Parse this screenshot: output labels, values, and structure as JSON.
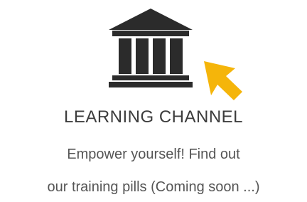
{
  "card": {
    "icon": "institution-building-icon",
    "pointer_icon": "cursor-arrow-icon",
    "title": "LEARNING CHANNEL",
    "description_line1": "Empower yourself! Find out",
    "description_line2": "our training pills (Coming soon ...)"
  },
  "colors": {
    "icon": "#2b2b2b",
    "pointer": "#f5b50a",
    "title": "#3c3c3c",
    "text": "#555555"
  }
}
